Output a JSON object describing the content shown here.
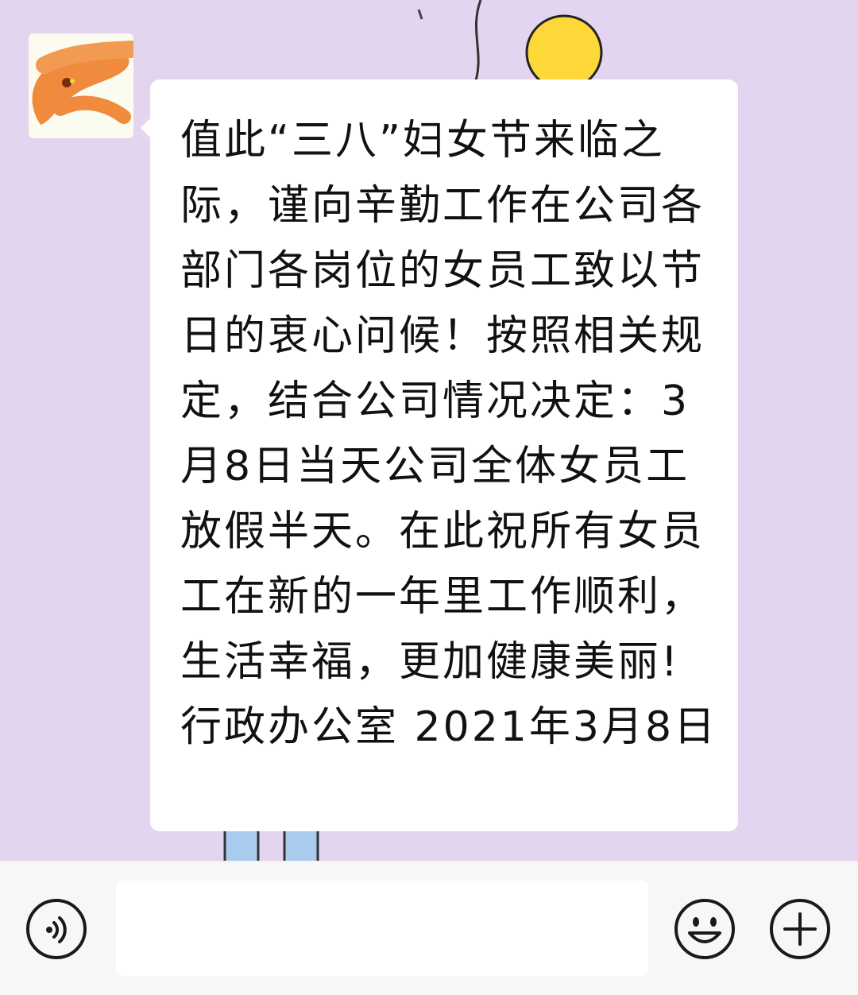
{
  "chat": {
    "message": {
      "text": "值此“三八”妇女节来临之际，谨向辛勤工作在公司各部门各岗位的女员工致以节日的衷心问候！按照相关规定，结合公司情况决定：3月8日当天公司全体女员工放假半天。在此祝所有女员工在新的一年里工作顺利，生活幸福，更加健康美丽!      行政办公室 2021年3月8日"
    }
  },
  "input_bar": {
    "input_value": "",
    "icons": {
      "voice": "voice-icon",
      "emoji": "emoji-icon",
      "plus": "plus-icon"
    }
  },
  "colors": {
    "chat_background": "#e3d4ef",
    "bubble": "#ffffff",
    "input_bar": "#f7f7f7",
    "avatar_scribble": "#f08a3c"
  }
}
